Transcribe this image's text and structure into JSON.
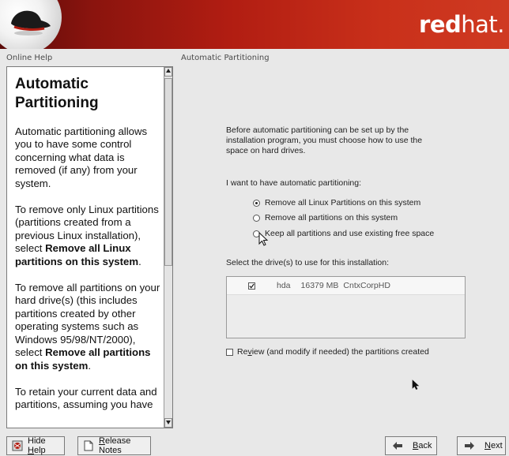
{
  "banner": {
    "brand_bold": "red",
    "brand_rest": "hat."
  },
  "help_pane": {
    "label": "Online Help",
    "title": "Automatic Partitioning",
    "para1": "Automatic partitioning allows you to have some control concerning what data is removed (if any) from your system.",
    "para2_pre": "To remove only Linux partitions (partitions created from a previous Linux installation), select ",
    "para2_bold": "Remove all Linux partitions on this system",
    "para2_post": ".",
    "para3_pre": "To remove all partitions on your hard drive(s) (this includes partitions created by other operating systems such as Windows 95/98/NT/2000), select ",
    "para3_bold": "Remove all partitions on this system",
    "para3_post": ".",
    "para4": "To retain your current data and partitions, assuming you have"
  },
  "main": {
    "label": "Automatic Partitioning",
    "intro": "Before automatic partitioning can be set up by the installation program, you must choose how to use the space on hard drives.",
    "prompt": "I want to have automatic partitioning:",
    "options": [
      {
        "label": "Remove all Linux Partitions on this system",
        "selected": true
      },
      {
        "label": "Remove all partitions on this system",
        "selected": false
      },
      {
        "label": "Keep all partitions and use existing free space",
        "selected": false
      }
    ],
    "drives_label": "Select the drive(s) to use for this installation:",
    "drives": [
      {
        "checked": true,
        "name": "hda",
        "size": "16379 MB",
        "model": "CntxCorpHD"
      }
    ],
    "review_pre": "Re",
    "review_underlined": "v",
    "review_post": "iew (and modify if needed) the partitions created",
    "review_checked": false
  },
  "bottom_bar": {
    "hide_help_pre": "Hide ",
    "hide_help_ul": "H",
    "hide_help_post": "elp",
    "release_notes_ul": "R",
    "release_notes_post": "elease Notes",
    "back_ul": "B",
    "back_post": "ack",
    "next_ul": "N",
    "next_post": "ext"
  },
  "colors": {
    "banner_dark": "#5a0a08",
    "banner_light": "#cf3a22",
    "background": "#e8e8e8"
  }
}
